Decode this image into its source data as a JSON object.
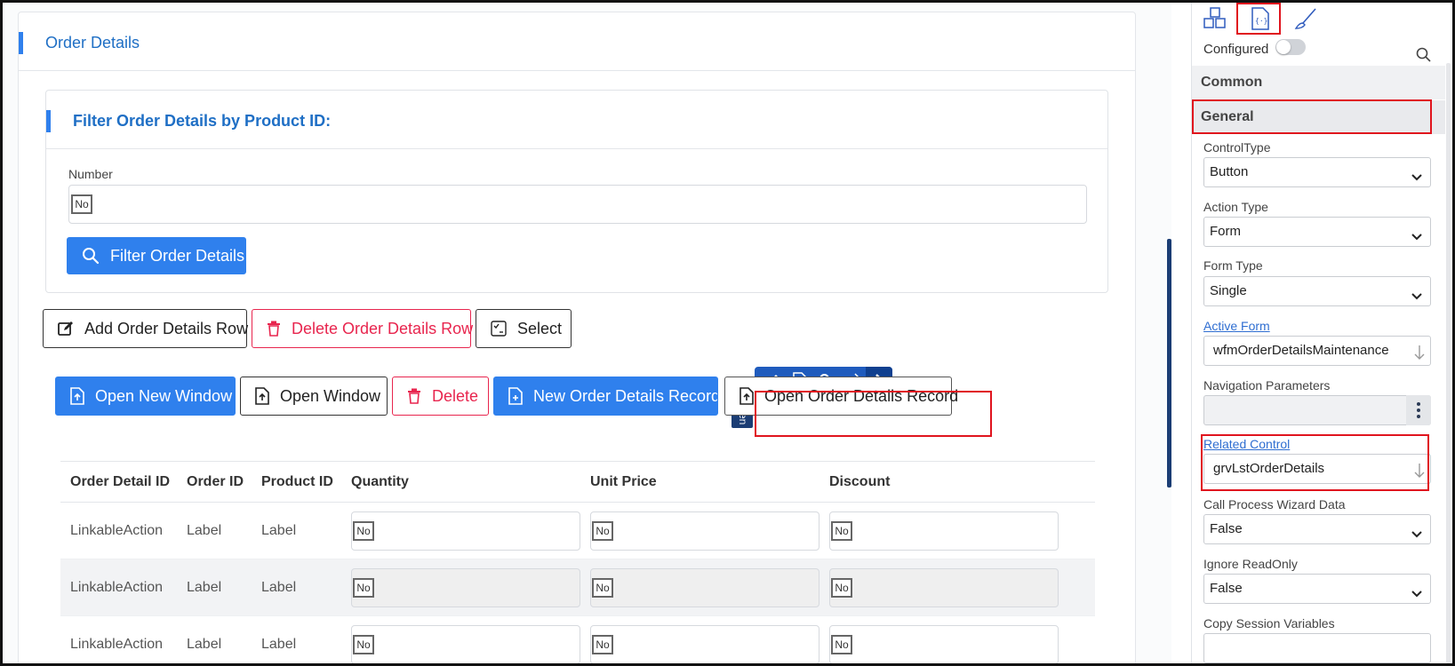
{
  "panel": {
    "title": "Order Details"
  },
  "filter": {
    "title": "Filter Order Details by Product ID:",
    "number_label": "Number",
    "number_placeholder": "No",
    "button": "Filter Order Details"
  },
  "actions_row1": [
    {
      "label": "Add Order Details Row",
      "icon": "edit-icon"
    },
    {
      "label": "Delete Order Details Row",
      "icon": "trash-icon"
    },
    {
      "label": "Select",
      "icon": "checklist-icon"
    }
  ],
  "actions_row2": [
    {
      "label": "Open New Window",
      "icon": "file-up-icon"
    },
    {
      "label": "Open Window",
      "icon": "file-up-icon"
    },
    {
      "label": "Delete",
      "icon": "trash-icon"
    },
    {
      "label": "New Order Details Record",
      "icon": "file-plus-icon"
    },
    {
      "label": "Open Order Details Record",
      "icon": "file-up-icon"
    }
  ],
  "open_tab": "Open",
  "grid": {
    "columns": [
      "Order Detail ID",
      "Order ID",
      "Product ID",
      "Quantity",
      "Unit Price",
      "Discount"
    ],
    "rows": [
      {
        "id": "LinkableAction",
        "order": "Label",
        "product": "Label",
        "qty": "No",
        "price": "No",
        "discount": "No"
      },
      {
        "id": "LinkableAction",
        "order": "Label",
        "product": "Label",
        "qty": "No",
        "price": "No",
        "discount": "No"
      },
      {
        "id": "LinkableAction",
        "order": "Label",
        "product": "Label",
        "qty": "No",
        "price": "No",
        "discount": "No"
      }
    ]
  },
  "props": {
    "configured_label": "Configured",
    "configured": false,
    "sections": {
      "common": "Common",
      "general": "General"
    },
    "fields": {
      "control_type": {
        "label": "ControlType",
        "value": "Button"
      },
      "action_type": {
        "label": "Action Type",
        "value": "Form"
      },
      "form_type": {
        "label": "Form Type",
        "value": "Single"
      },
      "active_form": {
        "label": "Active Form",
        "value": "wfmOrderDetailsMaintenance"
      },
      "nav_params": {
        "label": "Navigation Parameters",
        "value": ""
      },
      "related_control": {
        "label": "Related Control",
        "value": "grvLstOrderDetails"
      },
      "call_process": {
        "label": "Call Process Wizard Data",
        "value": "False"
      },
      "ignore_readonly": {
        "label": "Ignore ReadOnly",
        "value": "False"
      },
      "copy_session": {
        "label": "Copy Session Variables"
      }
    }
  },
  "colors": {
    "accent": "#2f80ed",
    "danger": "#e8254e",
    "highlight": "#e0141e",
    "title_blue": "#1f6fc5"
  }
}
